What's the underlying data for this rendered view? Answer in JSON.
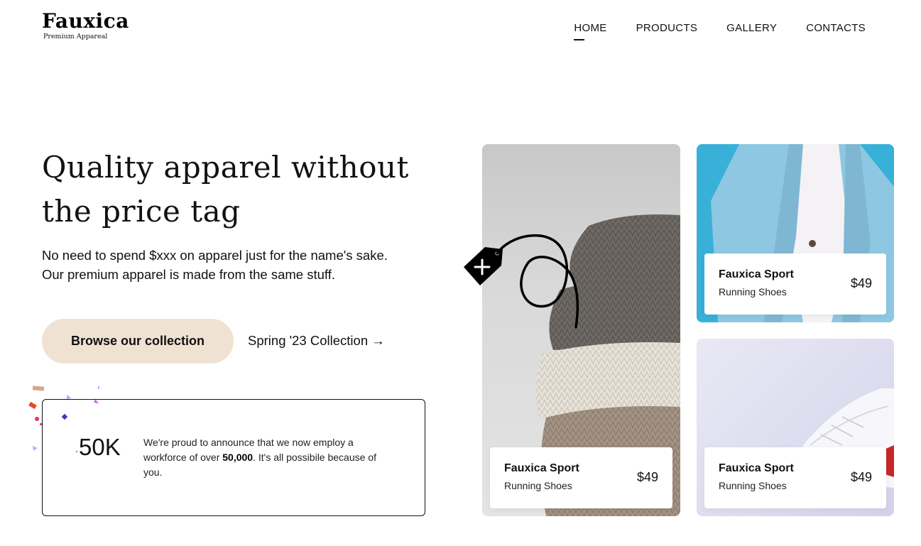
{
  "brand": {
    "name": "Fauxica",
    "tagline": "Premium Appareal"
  },
  "nav": {
    "items": [
      {
        "label": "HOME",
        "active": true
      },
      {
        "label": "PRODUCTS",
        "active": false
      },
      {
        "label": "GALLERY",
        "active": false
      },
      {
        "label": "CONTACTS",
        "active": false
      }
    ]
  },
  "hero": {
    "title": "Quality apparel without the price tag",
    "description_line1": "No need to spend $xxx on apparel just for the name's sake.",
    "description_line2": "Our premium apparel is made from the same stuff.",
    "cta_label": "Browse our collection",
    "collection_link": "Spring '23 Collection →"
  },
  "stat": {
    "number": "50K",
    "text_before": "We're proud to announce that we now employ a workforce of over ",
    "text_bold": "50,000",
    "text_after": ". It's all possibile because of you."
  },
  "products": [
    {
      "name": "Fauxica Sport",
      "subtitle": "Running Shoes",
      "price": "$49",
      "photo": "stacked-sweaters"
    },
    {
      "name": "Fauxica Sport",
      "subtitle": "Running Shoes",
      "price": "$49",
      "photo": "denim-jacket"
    },
    {
      "name": "Fauxica Sport",
      "subtitle": "Running Shoes",
      "price": "$49",
      "photo": "white-sneaker"
    }
  ],
  "colors": {
    "cta_background": "#f0e2d3",
    "text": "#111111",
    "accent_blue": "#3aaed6"
  },
  "icons": {
    "price_tag": "price-tag-icon",
    "arrow": "arrow-right-icon"
  }
}
